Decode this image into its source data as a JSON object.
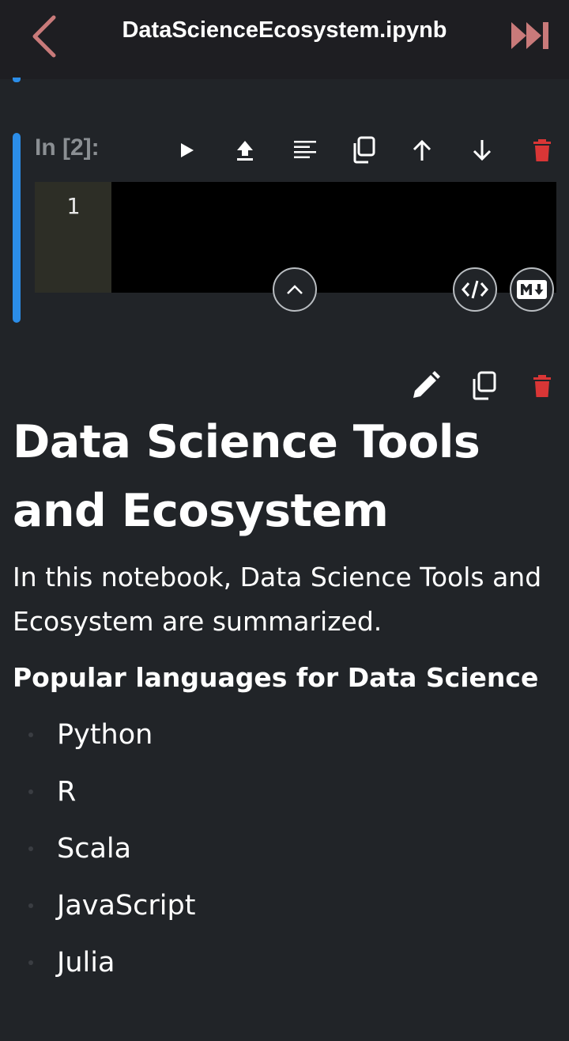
{
  "header": {
    "filename": "DataScienceEcosystem.ipynb",
    "back_icon": "chevron-left-icon",
    "run_all_icon": "fast-forward-icon",
    "accent_color": "#c97a7a"
  },
  "code_cell": {
    "prompt": "In [2]:",
    "line_number": "1",
    "toolbar": [
      "run-icon",
      "upload-icon",
      "format-icon",
      "copy-icon",
      "move-up-icon",
      "move-down-icon",
      "delete-icon"
    ],
    "accent_color": "#2b8de8",
    "delete_color": "#d93636"
  },
  "markdown_cell": {
    "toolbar": [
      "edit-icon",
      "copy-icon",
      "delete-icon"
    ],
    "heading": "Data Science Tools and Ecosystem",
    "intro": "In this notebook, Data Science Tools and Ecosystem are summarized.",
    "subheading": "Popular languages for Data Science",
    "languages": [
      "Python",
      "R",
      "Scala",
      "JavaScript",
      "Julia"
    ]
  }
}
